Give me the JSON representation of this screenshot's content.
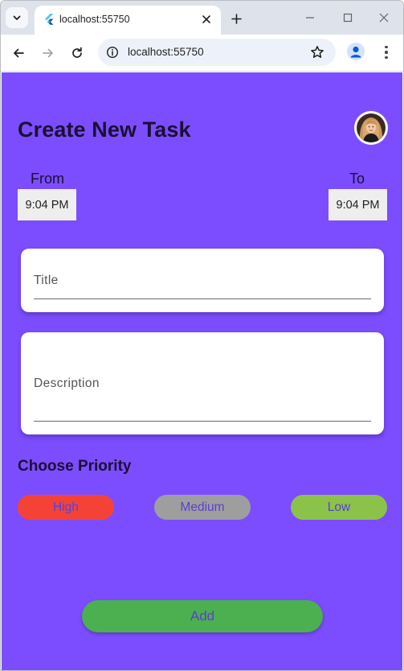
{
  "browser": {
    "tab_title": "localhost:55750",
    "url": "localhost:55750"
  },
  "header": {
    "title": "Create New Task"
  },
  "time": {
    "from_label": "From",
    "from_value": "9:04 PM",
    "to_label": "To",
    "to_value": "9:04 PM"
  },
  "form": {
    "title_label": "Title",
    "description_label": "Description"
  },
  "priority": {
    "heading": "Choose Priority",
    "options": [
      {
        "label": "High",
        "color": "#f44336"
      },
      {
        "label": "Medium",
        "color": "#9e9e9e"
      },
      {
        "label": "Low",
        "color": "#8bc34a"
      }
    ]
  },
  "actions": {
    "add_label": "Add"
  },
  "colors": {
    "background": "#7c4dff",
    "button_text": "#5d3fd3",
    "add_button": "#4caf50"
  }
}
